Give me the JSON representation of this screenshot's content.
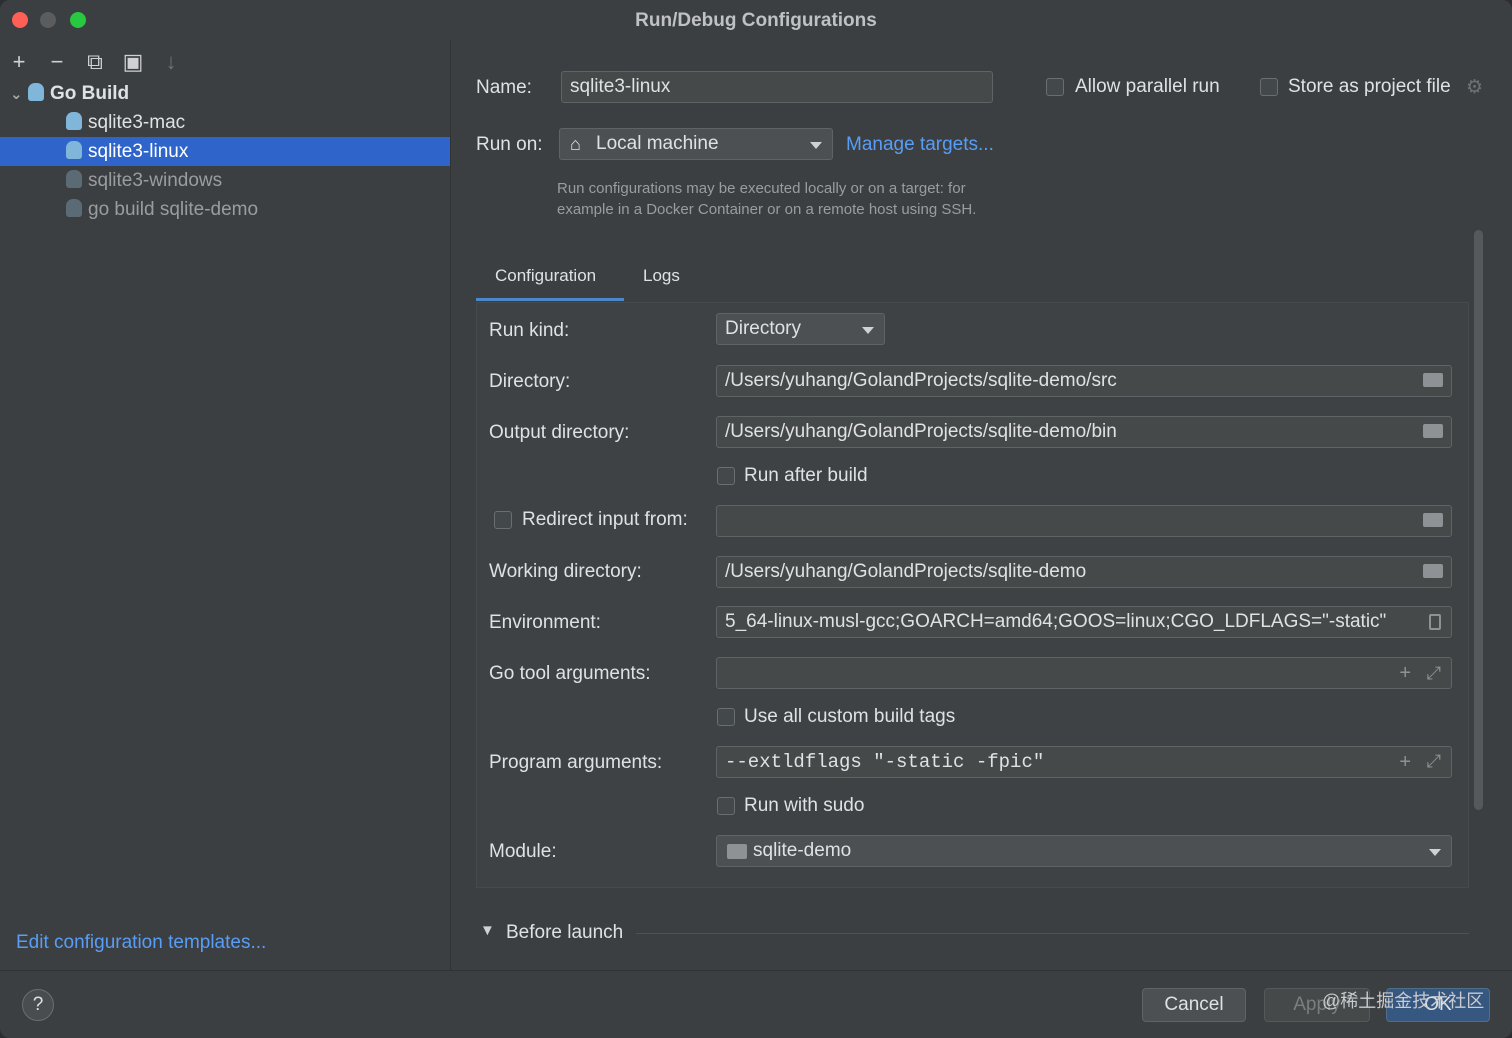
{
  "window": {
    "title": "Run/Debug Configurations"
  },
  "sidebar": {
    "toolbar": [
      "+",
      "−",
      "⧉",
      "▣",
      "↓"
    ],
    "group": "Go Build",
    "items": [
      {
        "label": "sqlite3-mac",
        "selected": false,
        "dim": false
      },
      {
        "label": "sqlite3-linux",
        "selected": true,
        "dim": false
      },
      {
        "label": "sqlite3-windows",
        "selected": false,
        "dim": true
      },
      {
        "label": "go build sqlite-demo",
        "selected": false,
        "dim": true
      }
    ],
    "edit_templates": "Edit configuration templates..."
  },
  "form": {
    "name_label": "Name:",
    "name_value": "sqlite3-linux",
    "allow_parallel": "Allow parallel run",
    "store_project": "Store as project file",
    "run_on_label": "Run on:",
    "run_on_value": "Local machine",
    "manage_targets": "Manage targets...",
    "hint_line1": "Run configurations may be executed locally or on a target: for",
    "hint_line2": "example in a Docker Container or on a remote host using SSH.",
    "tabs": [
      "Configuration",
      "Logs"
    ],
    "run_kind_label": "Run kind:",
    "run_kind_value": "Directory",
    "directory_label": "Directory:",
    "directory_value": "/Users/yuhang/GolandProjects/sqlite-demo/src",
    "output_label": "Output directory:",
    "output_value": "/Users/yuhang/GolandProjects/sqlite-demo/bin",
    "run_after_build": "Run after build",
    "redirect_label": "Redirect input from:",
    "working_label": "Working directory:",
    "working_value": "/Users/yuhang/GolandProjects/sqlite-demo",
    "env_label": "Environment:",
    "env_value": "5_64-linux-musl-gcc;GOARCH=amd64;GOOS=linux;CGO_LDFLAGS=\"-static\"",
    "go_tool_label": "Go tool arguments:",
    "custom_tags": "Use all custom build tags",
    "program_label": "Program arguments:",
    "program_value": "--extldflags \"-static -fpic\"",
    "run_sudo": "Run with sudo",
    "module_label": "Module:",
    "module_value": "sqlite-demo",
    "before_launch": "Before launch"
  },
  "footer": {
    "help": "?",
    "cancel": "Cancel",
    "apply": "Apply",
    "ok": "OK",
    "watermark": "@稀土掘金技术社区"
  },
  "colors": {
    "accent": "#2f65ca",
    "link": "#589df6",
    "ok_button": "#365880"
  }
}
